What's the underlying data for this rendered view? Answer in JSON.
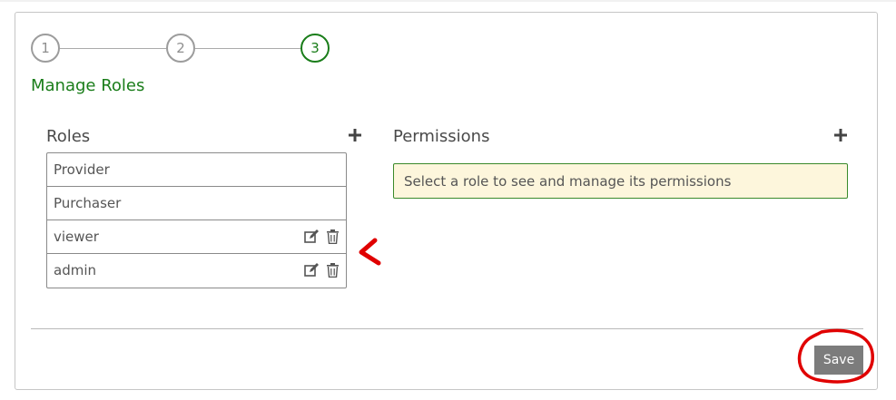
{
  "wizard": {
    "steps": [
      {
        "number": "1",
        "state": "inactive"
      },
      {
        "number": "2",
        "state": "inactive"
      },
      {
        "number": "3",
        "state": "active"
      }
    ],
    "title": "Manage Roles"
  },
  "roles": {
    "header": "Roles",
    "add_icon": "plus-icon",
    "items": [
      {
        "label": "Provider",
        "editable": false
      },
      {
        "label": "Purchaser",
        "editable": false
      },
      {
        "label": "viewer",
        "editable": true
      },
      {
        "label": "admin",
        "editable": true
      }
    ]
  },
  "permissions": {
    "header": "Permissions",
    "add_icon": "plus-icon",
    "placeholder": "Select a role to see and manage its permissions"
  },
  "footer": {
    "save_label": "Save"
  },
  "colors": {
    "accent_green": "#1a7d1a",
    "info_background": "#fdf6dc",
    "save_button": "#7c7c7c",
    "annotation_red": "#e00000"
  }
}
